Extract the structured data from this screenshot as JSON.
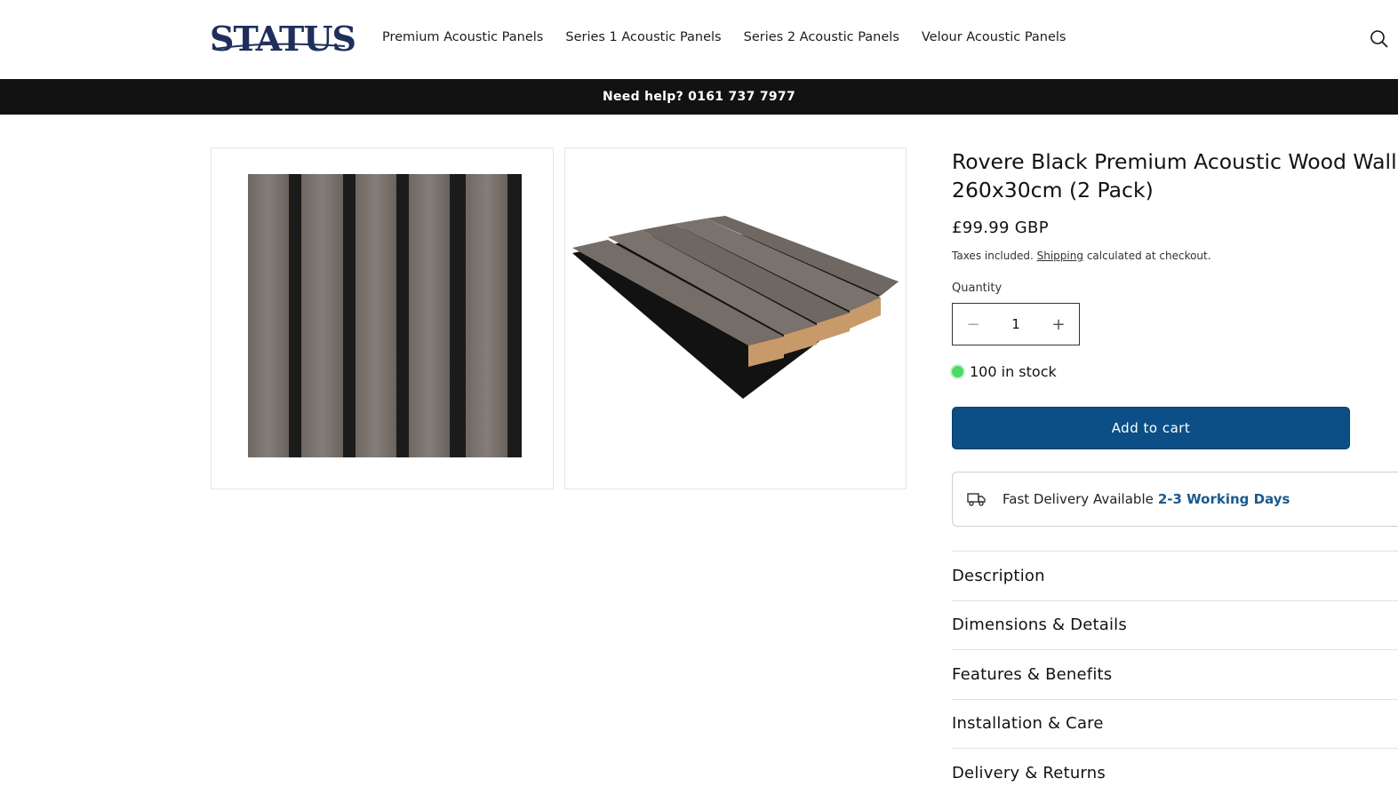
{
  "header": {
    "logo_text": "STATUS",
    "nav": [
      {
        "label": "Premium Acoustic Panels"
      },
      {
        "label": "Series 1 Acoustic Panels"
      },
      {
        "label": "Series 2 Acoustic Panels"
      },
      {
        "label": "Velour Acoustic Panels"
      }
    ],
    "search_icon": "search-icon"
  },
  "announcement": {
    "text": "Need help? 0161 737 7977"
  },
  "product": {
    "title_line1": "Rovere Black Premium Acoustic Wood Wall",
    "title_line2": "260x30cm (2 Pack)",
    "price": "£99.99 GBP",
    "tax_prefix": "Taxes included.",
    "shipping_link": "Shipping",
    "tax_suffix": "calculated at checkout.",
    "quantity_label": "Quantity",
    "quantity_value": "1",
    "stock_text": "100 in stock",
    "add_to_cart": "Add to cart",
    "delivery_text": "Fast Delivery Available",
    "delivery_accent": "2-3 Working Days",
    "delivery_icon": "truck-icon"
  },
  "accordion": [
    {
      "label": "Description"
    },
    {
      "label": "Dimensions & Details"
    },
    {
      "label": "Features & Benefits"
    },
    {
      "label": "Installation & Care"
    },
    {
      "label": "Delivery & Returns"
    }
  ],
  "colors": {
    "brand_navy": "#1f2f5c",
    "announcement_bg": "#121212",
    "button_blue": "#0b4f86",
    "stock_green": "#4cd964",
    "delivery_accent": "#1b5a8e"
  }
}
